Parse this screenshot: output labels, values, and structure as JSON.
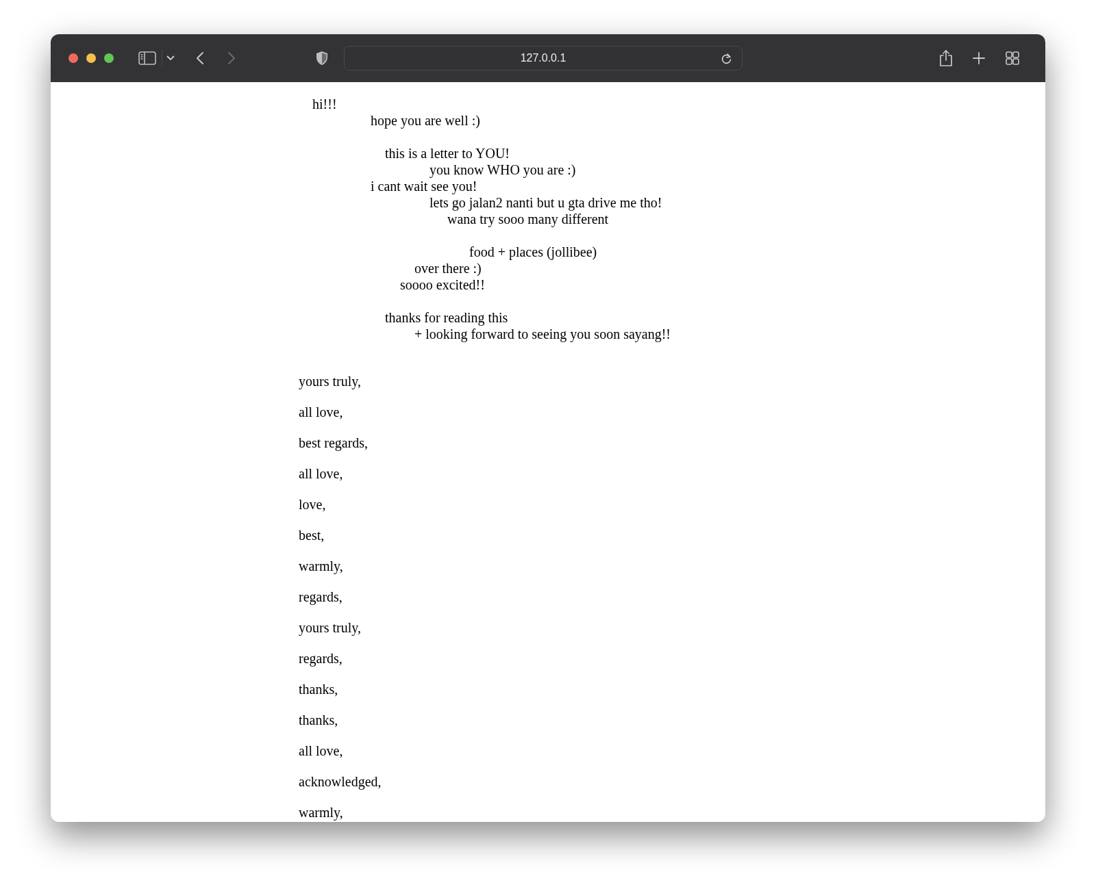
{
  "browser": {
    "url": "127.0.0.1"
  },
  "letter_lines": [
    "hi!!!",
    "hope you are well :)",
    "this is a letter to YOU!",
    "you know WHO you are :)",
    "i cant wait see you!",
    "lets go jalan2 nanti but u gta drive me tho!",
    "wana try sooo many different",
    "food + places (jollibee)",
    "over there :)",
    "soooo excited!!",
    "thanks for reading this",
    "+ looking forward to seeing you soon sayang!!"
  ],
  "signoffs": [
    "yours truly,",
    "all love,",
    "best regards,",
    "all love,",
    "love,",
    "best,",
    "warmly,",
    "regards,",
    "yours truly,",
    "regards,",
    "thanks,",
    "thanks,",
    "all love,",
    "acknowledged,",
    "warmly,"
  ]
}
